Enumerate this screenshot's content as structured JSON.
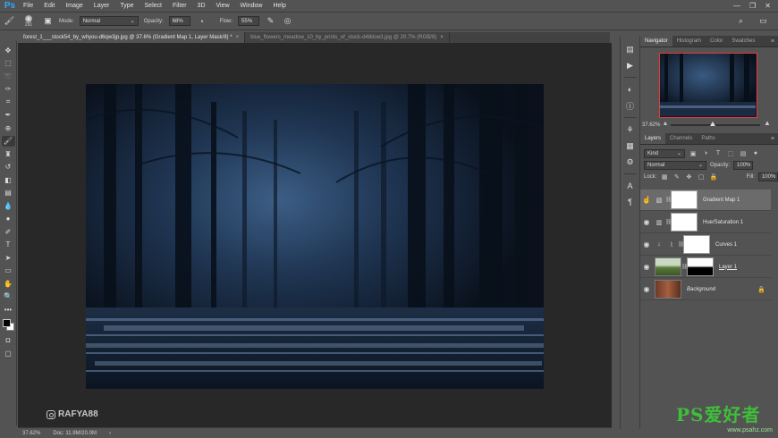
{
  "app": {
    "logo": "Ps"
  },
  "menu": [
    "File",
    "Edit",
    "Image",
    "Layer",
    "Type",
    "Select",
    "Filter",
    "3D",
    "View",
    "Window",
    "Help"
  ],
  "window_controls": [
    "—",
    "❐",
    "✕"
  ],
  "options_bar": {
    "brush_size": "291",
    "mode_label": "Mode:",
    "mode_value": "Normal",
    "opacity_label": "Opacity:",
    "opacity_value": "68%",
    "flow_label": "Flow:",
    "flow_value": "55%"
  },
  "tabs": [
    {
      "label": "forest_1___stock54_by_whyou-d6qw3jp.jpg @ 37.6% (Gradient Map 1, Layer Mask/8) *",
      "active": true
    },
    {
      "label": "blue_flowers_meadow_10_by_prints_of_stock-d48doe3.jpg @ 20.7% (RGB/8)",
      "active": false
    }
  ],
  "canvas": {
    "watermark": "RAFYA88"
  },
  "status": {
    "zoom": "37.62%",
    "doc": "Doc: 11.9M/20.0M"
  },
  "navigator_panel": {
    "tabs": [
      "Navigator",
      "Histogram",
      "Color",
      "Swatches"
    ],
    "zoom": "37.62%"
  },
  "layers_panel": {
    "tabs": [
      "Layers",
      "Channels",
      "Paths"
    ],
    "filter_kind": "Kind",
    "blend_mode": "Normal",
    "opacity_label": "Opacity:",
    "opacity_value": "100%",
    "lock_label": "Lock:",
    "fill_label": "Fill:",
    "fill_value": "100%",
    "layers": [
      {
        "name": "Gradient Map 1",
        "type": "adjustment",
        "selected": true
      },
      {
        "name": "Hue/Saturation 1",
        "type": "adjustment",
        "selected": false
      },
      {
        "name": "Curves 1",
        "type": "adjustment",
        "selected": false
      },
      {
        "name": "Layer 1",
        "type": "image",
        "selected": false
      },
      {
        "name": "Background",
        "type": "background",
        "selected": false
      }
    ]
  },
  "branding": {
    "main": "PS爱好者",
    "sub": "www.psahz.com"
  },
  "colors": {
    "ui_bg": "#535353",
    "canvas_bg": "#282828",
    "ps_blue": "#31a8ff",
    "nav_highlight": "#e53a3a",
    "badge_green": "#3fbf3a"
  }
}
